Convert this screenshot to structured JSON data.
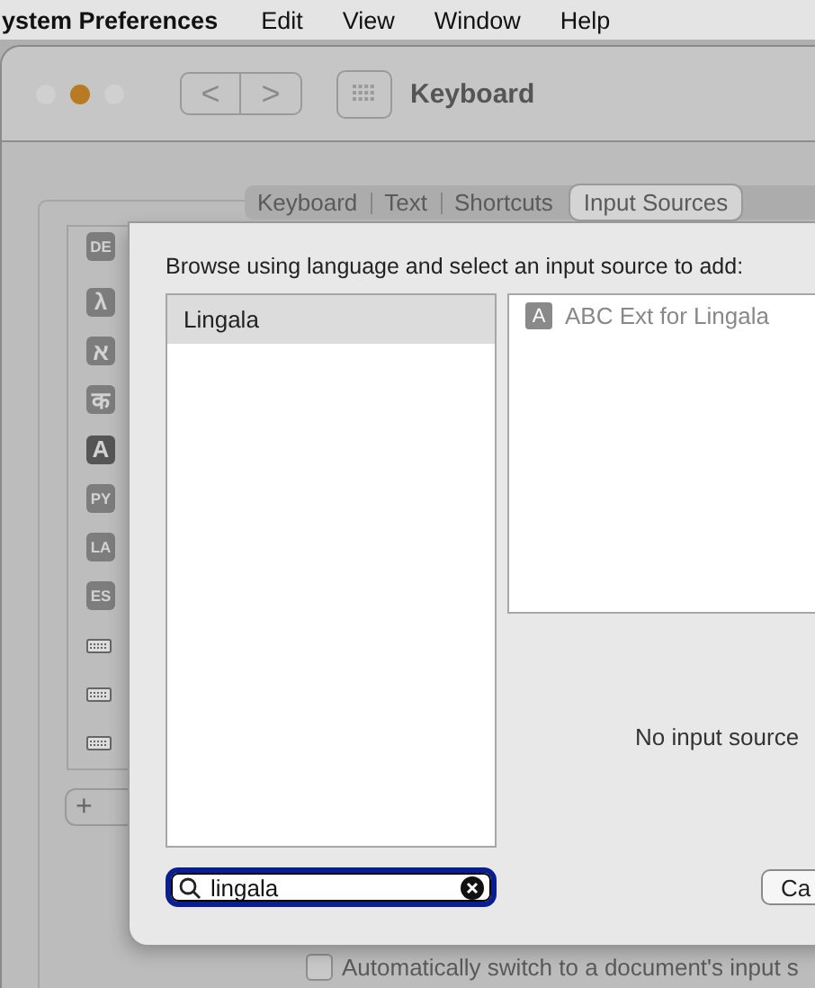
{
  "menu_bar": {
    "app": "ystem Preferences",
    "items": [
      "Edit",
      "View",
      "Window",
      "Help"
    ]
  },
  "window": {
    "title": "Keyboard",
    "nav_back": "<",
    "nav_forward": ">"
  },
  "tabs": [
    {
      "label": "Keyboard",
      "selected": false
    },
    {
      "label": "Text",
      "selected": false
    },
    {
      "label": "Shortcuts",
      "selected": false
    },
    {
      "label": "Input Sources",
      "selected": true
    }
  ],
  "sources": [
    {
      "kind": "badge",
      "label": "DE"
    },
    {
      "kind": "badge",
      "label": "λ"
    },
    {
      "kind": "badge",
      "label": "א"
    },
    {
      "kind": "badge",
      "label": "क"
    },
    {
      "kind": "dark-badge",
      "label": "A"
    },
    {
      "kind": "badge",
      "label": "PY"
    },
    {
      "kind": "badge",
      "label": "LA"
    },
    {
      "kind": "badge",
      "label": "ES"
    },
    {
      "kind": "keyboard"
    },
    {
      "kind": "keyboard"
    },
    {
      "kind": "keyboard"
    }
  ],
  "list_buttons": [
    "+"
  ],
  "auto_switch": {
    "label": "Automatically switch to a document's input s",
    "checked": false
  },
  "sheet": {
    "prompt": "Browse using language and select an input source to add:",
    "languages": [
      {
        "label": "Lingala",
        "selected": true
      }
    ],
    "input_sources": [
      {
        "badge": "A",
        "label": "ABC Ext for Lingala",
        "disabled": true
      }
    ],
    "preview": "No input source",
    "search": {
      "value": "lingala"
    },
    "cancel": "Ca"
  }
}
